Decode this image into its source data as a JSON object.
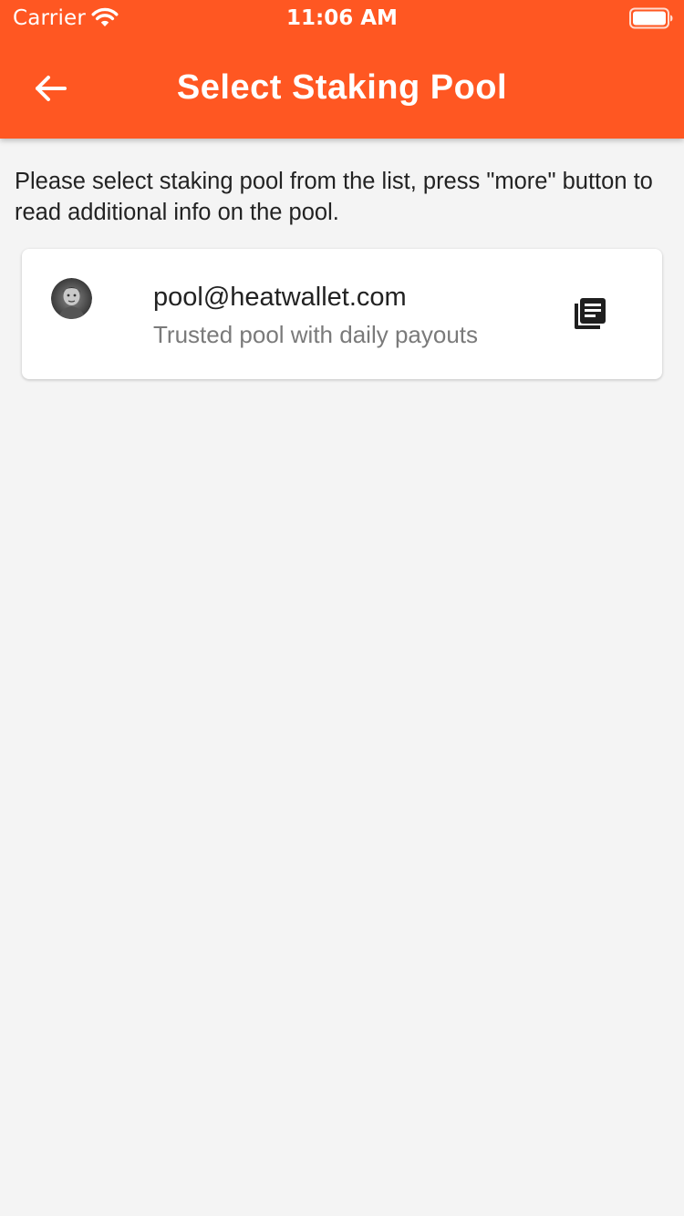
{
  "status_bar": {
    "carrier": "Carrier",
    "time": "11:06 AM",
    "wifi_icon": "wifi-icon",
    "battery_icon": "battery-icon"
  },
  "app_bar": {
    "title": "Select Staking Pool",
    "back_icon": "arrow-back-icon",
    "background_color": "#ff5722"
  },
  "instructions": "Please select staking pool from the list, press \"more\" button to read additional info on the pool.",
  "pools": [
    {
      "name": "pool@heatwallet.com",
      "description": "Trusted pool with daily payouts",
      "avatar_icon": "pool-avatar",
      "more_icon": "library-books-icon"
    }
  ],
  "colors": {
    "accent": "#ff5722",
    "background": "#f4f4f4",
    "card": "#ffffff",
    "secondary_text": "#7a7a7a"
  }
}
